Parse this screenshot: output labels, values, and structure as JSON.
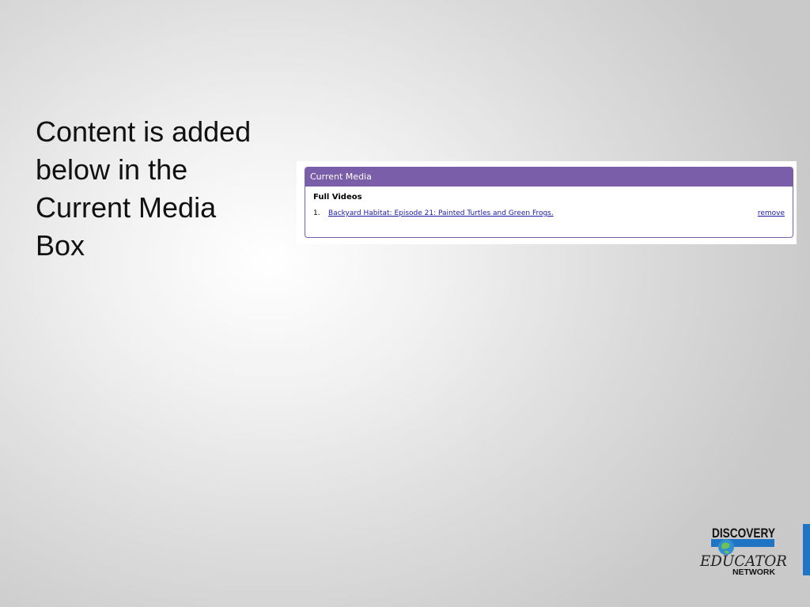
{
  "slide": {
    "text_lines": [
      "Content is added",
      "below in the",
      "Current Media",
      "Box"
    ]
  },
  "media_box": {
    "header": "Current Media",
    "section_title": "Full Videos",
    "items": [
      {
        "number": "1.",
        "title": "Backyard Habitat: Episode 21: Painted Turtles and Green Frogs.",
        "action": "remove"
      }
    ]
  },
  "logo": {
    "line1": "DISCOVERY",
    "line2": "EDUCATOR",
    "line3": "NETWORK"
  },
  "colors": {
    "header_purple": "#7b5eaa",
    "link_blue": "#1a1aa6",
    "accent_blue": "#1f74c4"
  }
}
